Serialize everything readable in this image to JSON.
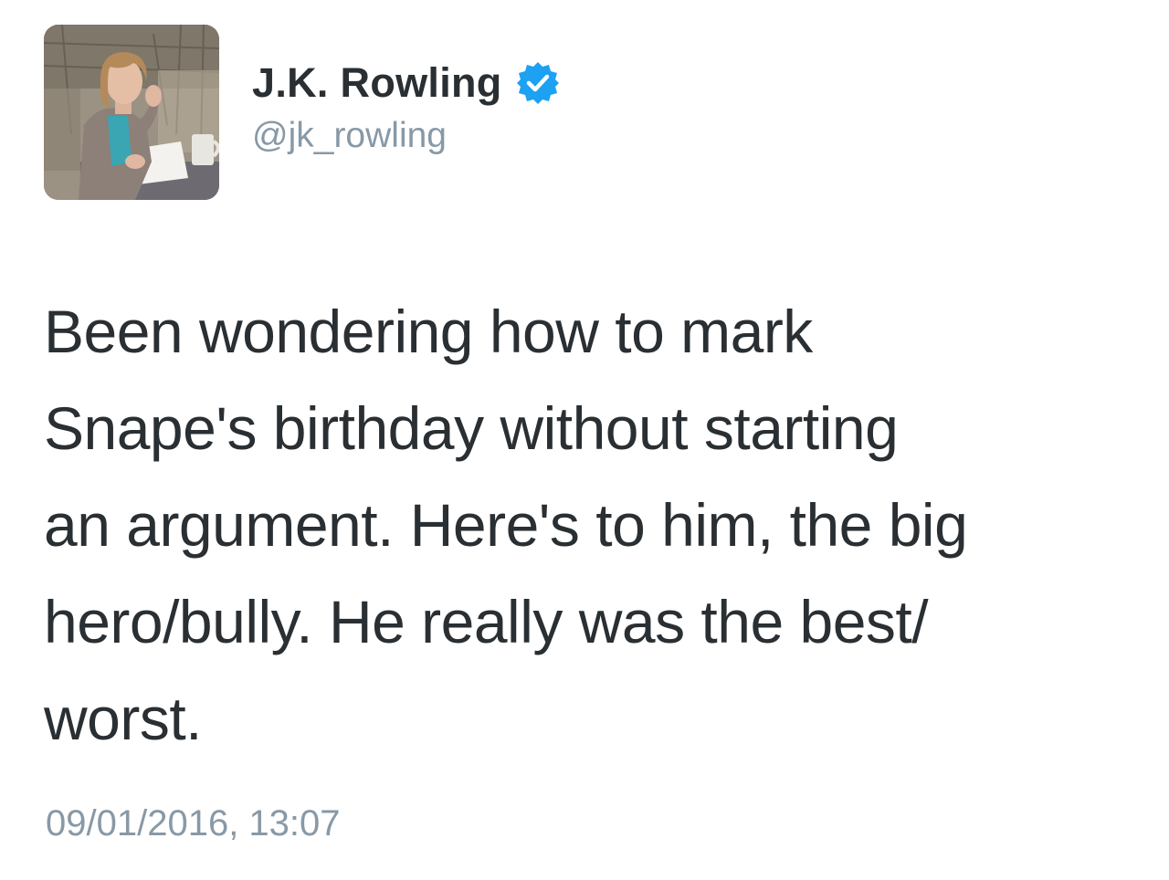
{
  "author": {
    "display_name": "J.K. Rowling",
    "handle": "@jk_rowling",
    "verified": true,
    "verified_color": "#1da1f2",
    "avatar_icon": "profile-photo"
  },
  "tweet": {
    "lines": [
      "Been wondering how to mark",
      "Snape's birthday without starting",
      "an argument. Here's to him, the big",
      "hero/bully. He really was the best/",
      "worst."
    ],
    "timestamp": "09/01/2016, 13:07"
  },
  "colors": {
    "text": "#292f33",
    "secondary_text": "#8899a6",
    "background": "#ffffff"
  }
}
